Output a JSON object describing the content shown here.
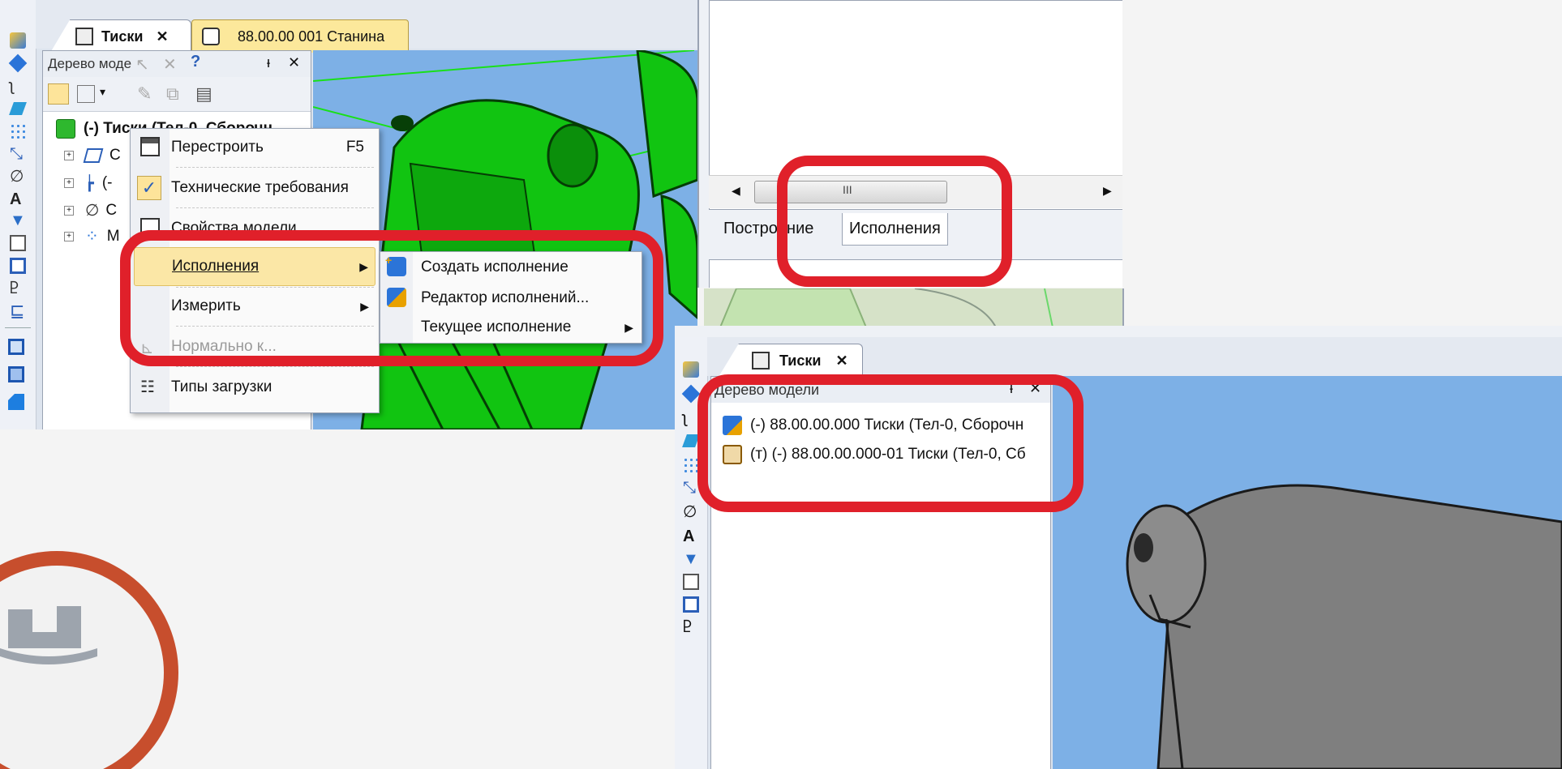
{
  "colors": {
    "accent_red": "#e0202a",
    "viewport_blue": "#7db0e6",
    "model_green": "#11c411",
    "menu_highlight": "#fbe7a6"
  },
  "left_window": {
    "tabs": [
      {
        "label": "Тиски",
        "close": "✕",
        "icon": "assembly-icon"
      },
      {
        "label": "88.00.00 001 Станина",
        "icon": "part-icon"
      }
    ],
    "tree_panel": {
      "title": "Дерево моде",
      "pin": "ᵻ",
      "close": "✕",
      "root": "(-) Тиски (Тел-0, Сборочн...",
      "items": [
        {
          "label": "С",
          "icon": "sketch-icon"
        },
        {
          "label": "(-",
          "icon": "tree-icon"
        },
        {
          "label": "С",
          "icon": "clip-icon"
        },
        {
          "label": "М",
          "icon": "dots-icon"
        }
      ]
    }
  },
  "context_menu": {
    "items": [
      {
        "label": "Перестроить",
        "shortcut": "F5",
        "icon": "rebuild-icon"
      },
      {
        "label": "Технические требования",
        "icon": "check-icon"
      },
      {
        "label": "Свойства модели",
        "icon": "properties-icon"
      },
      {
        "label": "Исполнения",
        "icon": ""
      },
      {
        "label": "Измерить",
        "icon": ""
      },
      {
        "label": "Нормально к...",
        "icon": "normal-icon"
      },
      {
        "label": "Типы загрузки",
        "icon": "load-types-icon"
      }
    ],
    "submenu": [
      {
        "label": "Создать исполнение",
        "icon": "create-variant-icon"
      },
      {
        "label": "Редактор исполнений...",
        "icon": "variants-editor-icon"
      },
      {
        "label": "Текущее исполнение",
        "icon": ""
      }
    ]
  },
  "right_top": {
    "scroll_thumb_grip": "III",
    "tabs": [
      "Построение",
      "Исполнения"
    ]
  },
  "right_bottom": {
    "tab": {
      "label": "Тиски",
      "close": "✕"
    },
    "tree_panel": {
      "title": "Дерево модели",
      "pin": "ᵻ",
      "close": "✕",
      "items": [
        "(-) 88.00.00.000 Тиски (Тел-0, Сборочн",
        "(т) (-) 88.00.00.000-01 Тиски (Тел-0, Сб"
      ]
    }
  }
}
